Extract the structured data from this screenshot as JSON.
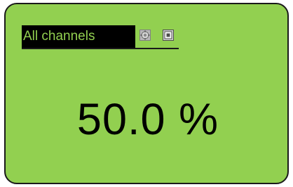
{
  "widget": {
    "title": "All channels",
    "value": "50.0 %",
    "background_color": "#92d050",
    "title_bg_color": "#000000",
    "title_text_color": "#92d050"
  },
  "icons": {
    "settings": "gear-icon",
    "window": "frame-icon"
  }
}
